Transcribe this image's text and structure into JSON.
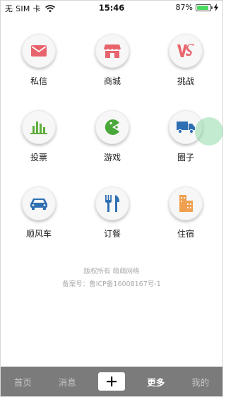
{
  "status_bar": {
    "carrier": "无 SIM 卡",
    "time": "15:46",
    "battery_percent": "87%",
    "battery_level": 0.87,
    "battery_color": "#4cd964"
  },
  "grid": {
    "items": [
      {
        "label": "私信",
        "icon": "envelope-icon",
        "color": "#e8646c"
      },
      {
        "label": "商城",
        "icon": "storefront-icon",
        "color": "#e8646c"
      },
      {
        "label": "挑战",
        "icon": "vs-icon",
        "color": "#e8646c"
      },
      {
        "label": "投票",
        "icon": "bar-chart-icon",
        "color": "#5fae3c"
      },
      {
        "label": "游戏",
        "icon": "pacman-icon",
        "color": "#4aa83a"
      },
      {
        "label": "圈子",
        "icon": "truck-icon",
        "color": "#2f6fb3"
      },
      {
        "label": "顺风车",
        "icon": "car-icon",
        "color": "#2f6fb3"
      },
      {
        "label": "订餐",
        "icon": "cutlery-icon",
        "color": "#2f6fb3"
      },
      {
        "label": "住宿",
        "icon": "building-icon",
        "color": "#f0a050"
      }
    ]
  },
  "copyright": {
    "line1": "版权所有 萌萌网络",
    "line2": "备案号：鲁ICP备16008167号-1"
  },
  "tabbar": {
    "home": "首页",
    "messages": "消息",
    "more": "更多",
    "mine": "我的",
    "background": "#7b7b7b"
  }
}
